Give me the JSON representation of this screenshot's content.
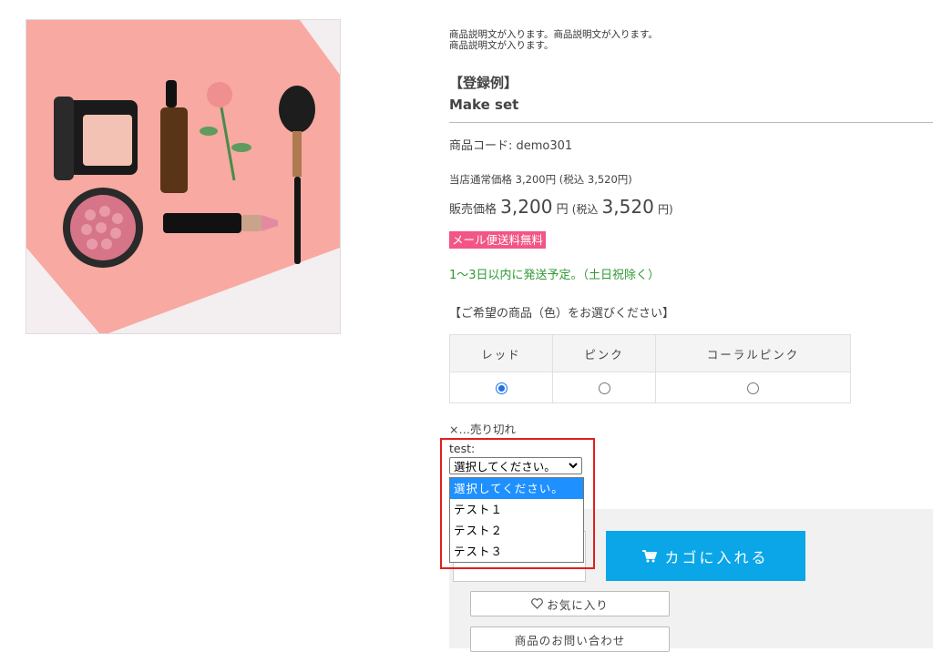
{
  "description": {
    "line1": "商品説明文が入ります。商品説明文が入ります。",
    "line2": "商品説明文が入ります。"
  },
  "example_heading": "【登録例】",
  "product_name": "Make set",
  "product_code": "商品コード: demo301",
  "normal_price": "当店通常価格 3,200円 (税込 3,520円)",
  "sale_price": {
    "label": "販売価格",
    "price": "3,200",
    "yen": "円",
    "tax_open": "(税込",
    "tax_price": "3,520",
    "tax_close": "円)"
  },
  "badge": "メール便送料無料",
  "shipping": "1〜3日以内に発送予定。（土日祝除く）",
  "choose_heading": "【ご希望の商品（色）をお選びください】",
  "variants": {
    "headers": [
      "レッド",
      "ピンク",
      "コーラルピンク"
    ],
    "selected_index": 0
  },
  "soldout_note": "×…売り切れ",
  "test_select": {
    "label": "test:",
    "value": "選択してください。",
    "options": [
      "選択してください。",
      "テスト１",
      "テスト２",
      "テスト３"
    ],
    "highlighted_index": 0
  },
  "buttons": {
    "cart": "カゴに入れる",
    "favorite": "お気に入り",
    "inquiry": "商品のお問い合わせ"
  },
  "icons": {
    "cart": "cart-icon",
    "heart": "heart-icon",
    "chevron": "chevron-down-icon"
  },
  "colors": {
    "badge": "#f25586",
    "shipping_text": "#2e9a33",
    "cart_button": "#0aa6e8",
    "highlight_border": "#e02020",
    "option_selected": "#1e90ff"
  }
}
